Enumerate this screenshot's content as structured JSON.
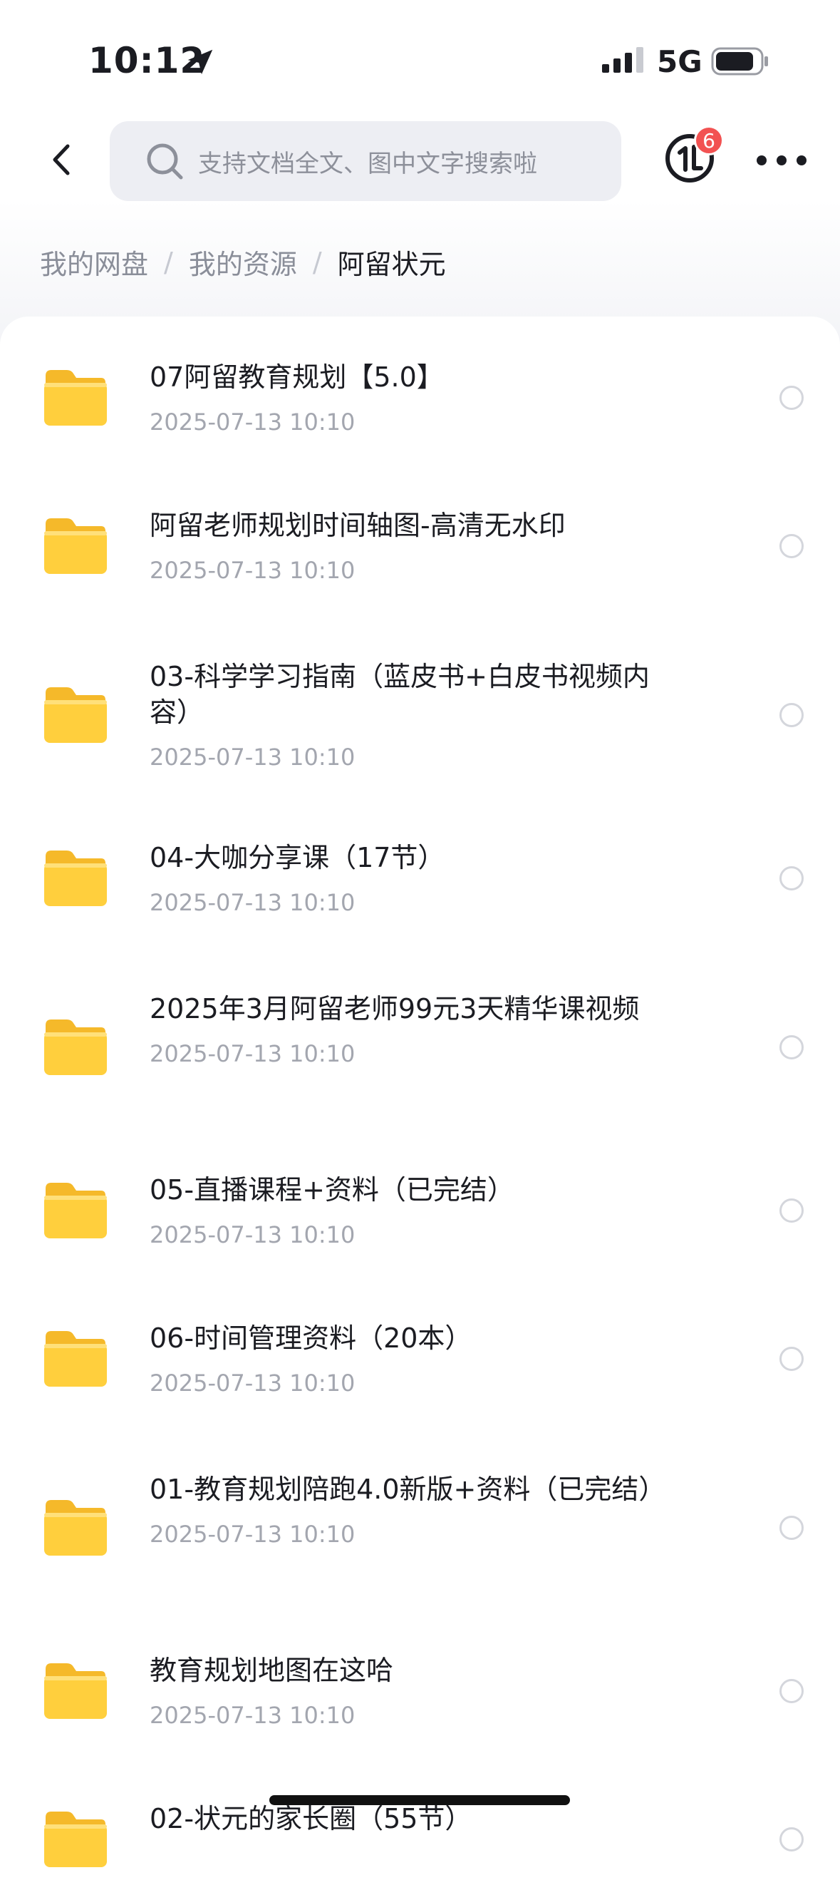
{
  "status": {
    "time": "10:12",
    "network": "5G"
  },
  "header": {
    "search_placeholder": "支持文档全文、图中文字搜索啦",
    "badge_count": "6"
  },
  "breadcrumb": [
    "我的网盘",
    "我的资源",
    "阿留状元"
  ],
  "breadcrumb_sep": "/",
  "items": [
    {
      "title": "07阿留教育规划【5.0】",
      "date": "2025-07-13 10:10"
    },
    {
      "title": "阿留老师规划时间轴图-高清无水印",
      "date": "2025-07-13 10:10"
    },
    {
      "title": "03-科学学习指南（蓝皮书+白皮书视频内容）",
      "date": "2025-07-13 10:10"
    },
    {
      "title": "04-大咖分享课（17节）",
      "date": "2025-07-13 10:10"
    },
    {
      "title": "2025年3月阿留老师99元3天精华课视频",
      "date": "2025-07-13 10:10"
    },
    {
      "title": "05-直播课程+资料（已完结）",
      "date": "2025-07-13 10:10"
    },
    {
      "title": "06-时间管理资料（20本）",
      "date": "2025-07-13 10:10"
    },
    {
      "title": "01-教育规划陪跑4.0新版+资料（已完结）",
      "date": "2025-07-13 10:10"
    },
    {
      "title": "教育规划地图在这哈",
      "date": "2025-07-13 10:10"
    },
    {
      "title": "02-状元的家长圈（55节）",
      "date": ""
    }
  ],
  "colors": {
    "folder": "#ffcc33",
    "badge": "#f25252",
    "accent_text": "#1b1c22"
  }
}
